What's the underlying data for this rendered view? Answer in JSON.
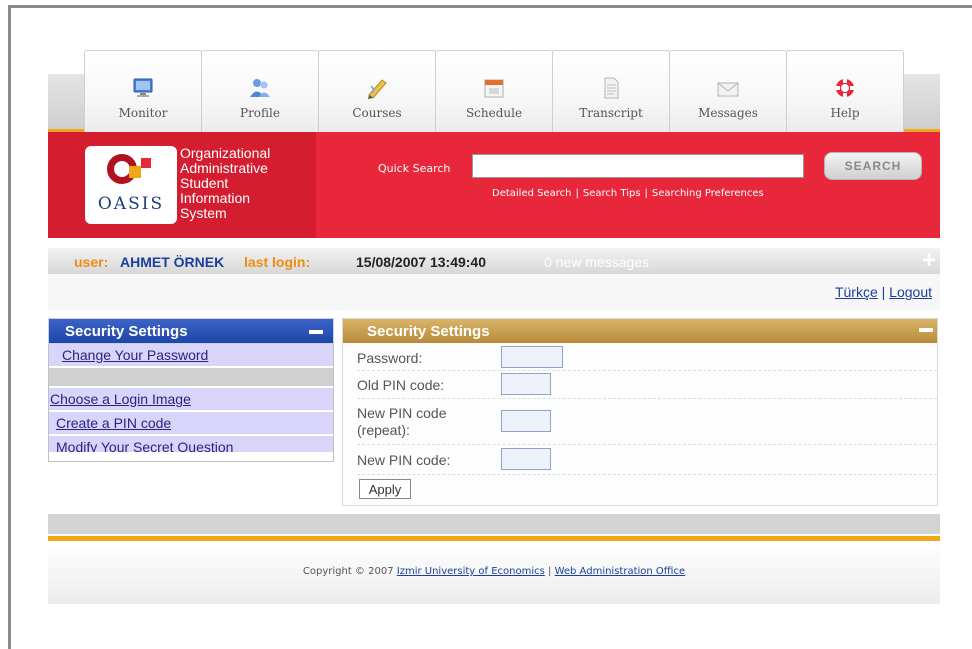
{
  "tabs": [
    {
      "label": "Monitor",
      "icon": "monitor-icon"
    },
    {
      "label": "Profile",
      "icon": "people-icon"
    },
    {
      "label": "Courses",
      "icon": "pencil-icon"
    },
    {
      "label": "Schedule",
      "icon": "calendar-icon"
    },
    {
      "label": "Transcript",
      "icon": "document-icon"
    },
    {
      "label": "Messages",
      "icon": "envelope-icon"
    },
    {
      "label": "Help",
      "icon": "lifebuoy-icon"
    }
  ],
  "header": {
    "logo_text": "OASIS",
    "org_lines": [
      "Organizational",
      "Administrative",
      "Student",
      "Information",
      "System"
    ],
    "quick_search_label": "Quick Search",
    "quick_search_value": "",
    "links": [
      "Detailed Search",
      "Search Tips",
      "Searching Preferences"
    ],
    "search_button": "SEARCH"
  },
  "userbar": {
    "user_label": "user:",
    "user_name": "AHMET ÖRNEK",
    "last_login_label": "last login:",
    "last_login": "15/08/2007 13:49:40",
    "messages": "0 new messages"
  },
  "lang": {
    "turkish": "Türkçe",
    "separator": "|",
    "logout": "Logout"
  },
  "left_panel": {
    "title": "Security Settings",
    "items": [
      "Change Your Password",
      "Choose a Login Image",
      "Create a PIN code",
      "Modify Your Secret Question"
    ]
  },
  "right_panel": {
    "title": "Security Settings",
    "fields": [
      {
        "label": "Password:",
        "value": ""
      },
      {
        "label": "Old PIN code:",
        "value": ""
      },
      {
        "label": "New PIN code (repeat):",
        "value": ""
      },
      {
        "label": "New PIN code:",
        "value": ""
      }
    ],
    "apply": "Apply"
  },
  "footer": {
    "copyright": "Copyright © 2007",
    "university": "Izmir University of Economics",
    "separator": "|",
    "office": "Web Administration Office"
  },
  "colors": {
    "header_red": "#e8283a",
    "accent_orange": "#f0a818",
    "left_panel_blue": "#1d46a8",
    "right_panel_gold": "#b88a38"
  }
}
